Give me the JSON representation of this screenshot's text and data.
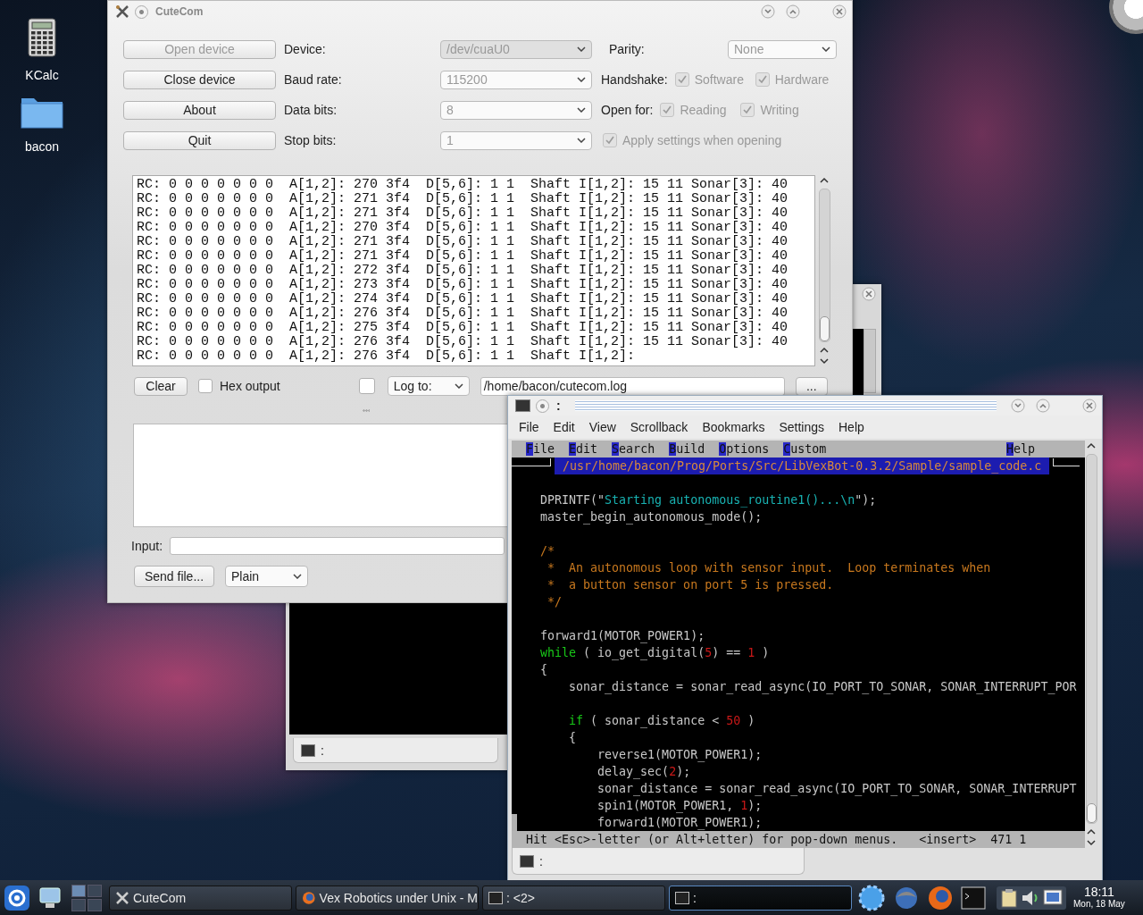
{
  "desktop_icons": [
    {
      "kind": "calculator",
      "label": "KCalc"
    },
    {
      "kind": "folder",
      "label": "bacon"
    }
  ],
  "background_terminal": {
    "tab_label": ":"
  },
  "cutecom": {
    "title": "CuteCom",
    "buttons": [
      {
        "label": "Open device",
        "disabled": true
      },
      {
        "label": "Close device",
        "disabled": false
      },
      {
        "label": "About",
        "disabled": false
      },
      {
        "label": "Quit",
        "disabled": false
      }
    ],
    "settings": [
      {
        "label": "Device:",
        "value": "/dev/cuaU0",
        "kind": "editable",
        "disabled": true
      },
      {
        "label": "Baud rate:",
        "value": "115200",
        "kind": "list",
        "disabled": true
      },
      {
        "label": "Data bits:",
        "value": "8",
        "kind": "list",
        "disabled": true
      },
      {
        "label": "Stop bits:",
        "value": "1",
        "kind": "list",
        "disabled": true
      }
    ],
    "parity": {
      "label": "Parity:",
      "value": "None",
      "disabled": true
    },
    "handshake": {
      "label": "Handshake:",
      "options": [
        {
          "label": "Software",
          "checked": true,
          "disabled": true
        },
        {
          "label": "Hardware",
          "checked": true,
          "disabled": true
        }
      ]
    },
    "open_for": {
      "label": "Open for:",
      "options": [
        {
          "label": "Reading",
          "checked": true,
          "disabled": true
        },
        {
          "label": "Writing",
          "checked": true,
          "disabled": true
        }
      ]
    },
    "apply_settings": {
      "label": "Apply settings when opening",
      "checked": true,
      "disabled": true
    },
    "output_lines": [
      "RC: 0 0 0 0 0 0 0  A[1,2]: 270 3f4  D[5,6]: 1 1  Shaft I[1,2]: 15 11 Sonar[3]: 40",
      "RC: 0 0 0 0 0 0 0  A[1,2]: 271 3f4  D[5,6]: 1 1  Shaft I[1,2]: 15 11 Sonar[3]: 40",
      "RC: 0 0 0 0 0 0 0  A[1,2]: 271 3f4  D[5,6]: 1 1  Shaft I[1,2]: 15 11 Sonar[3]: 40",
      "RC: 0 0 0 0 0 0 0  A[1,2]: 270 3f4  D[5,6]: 1 1  Shaft I[1,2]: 15 11 Sonar[3]: 40",
      "RC: 0 0 0 0 0 0 0  A[1,2]: 271 3f4  D[5,6]: 1 1  Shaft I[1,2]: 15 11 Sonar[3]: 40",
      "RC: 0 0 0 0 0 0 0  A[1,2]: 271 3f4  D[5,6]: 1 1  Shaft I[1,2]: 15 11 Sonar[3]: 40",
      "RC: 0 0 0 0 0 0 0  A[1,2]: 272 3f4  D[5,6]: 1 1  Shaft I[1,2]: 15 11 Sonar[3]: 40",
      "RC: 0 0 0 0 0 0 0  A[1,2]: 273 3f4  D[5,6]: 1 1  Shaft I[1,2]: 15 11 Sonar[3]: 40",
      "RC: 0 0 0 0 0 0 0  A[1,2]: 274 3f4  D[5,6]: 1 1  Shaft I[1,2]: 15 11 Sonar[3]: 40",
      "RC: 0 0 0 0 0 0 0  A[1,2]: 276 3f4  D[5,6]: 1 1  Shaft I[1,2]: 15 11 Sonar[3]: 40",
      "RC: 0 0 0 0 0 0 0  A[1,2]: 275 3f4  D[5,6]: 1 1  Shaft I[1,2]: 15 11 Sonar[3]: 40",
      "RC: 0 0 0 0 0 0 0  A[1,2]: 276 3f4  D[5,6]: 1 1  Shaft I[1,2]: 15 11 Sonar[3]: 40",
      "RC: 0 0 0 0 0 0 0  A[1,2]: 276 3f4  D[5,6]: 1 1  Shaft I[1,2]:"
    ],
    "clear_button": "Clear",
    "hex_output": {
      "label": "Hex output",
      "checked": false
    },
    "log": {
      "checked": false,
      "mode": "Log to:",
      "path": "/home/bacon/cutecom.log",
      "browse_button": "..."
    },
    "input": {
      "label": "Input:"
    },
    "send_file_button": "Send file...",
    "line_end": "Plain"
  },
  "konsole": {
    "title": ":",
    "menu": [
      "File",
      "Edit",
      "View",
      "Scrollback",
      "Bookmarks",
      "Settings",
      "Help"
    ],
    "editor": {
      "menu": [
        "File",
        "Edit",
        "Search",
        "Build",
        "Options",
        "Custom",
        "Help"
      ],
      "file_path": "/usr/home/bacon/Prog/Ports/Src/LibVexBot-0.3.2/Sample/sample_code.c",
      "lines": [
        {
          "kind": "blank"
        },
        {
          "kind": "code",
          "segments": [
            {
              "t": "DPRINTF(\"",
              "kind": "plain"
            },
            {
              "t": "Starting autonomous_routine1()...\\n",
              "kind": "string"
            },
            {
              "t": "\");",
              "kind": "plain"
            }
          ]
        },
        {
          "kind": "code",
          "segments": [
            {
              "t": "master_begin_autonomous_mode();",
              "kind": "plain"
            }
          ]
        },
        {
          "kind": "blank"
        },
        {
          "kind": "code",
          "segments": [
            {
              "t": "/*",
              "kind": "comment"
            }
          ]
        },
        {
          "kind": "code",
          "segments": [
            {
              "t": " *  An autonomous loop with sensor input.  Loop terminates when",
              "kind": "comment"
            }
          ]
        },
        {
          "kind": "code",
          "segments": [
            {
              "t": " *  a button sensor on port 5 is pressed.",
              "kind": "comment"
            }
          ]
        },
        {
          "kind": "code",
          "segments": [
            {
              "t": " */",
              "kind": "comment"
            }
          ]
        },
        {
          "kind": "blank"
        },
        {
          "kind": "code",
          "segments": [
            {
              "t": "forward1(MOTOR_POWER1);",
              "kind": "plain"
            }
          ]
        },
        {
          "kind": "code",
          "segments": [
            {
              "t": "while",
              "kind": "keyword"
            },
            {
              "t": " ( io_get_digital(",
              "kind": "plain"
            },
            {
              "t": "5",
              "kind": "number"
            },
            {
              "t": ") == ",
              "kind": "plain"
            },
            {
              "t": "1",
              "kind": "number"
            },
            {
              "t": " )",
              "kind": "plain"
            }
          ]
        },
        {
          "kind": "code",
          "segments": [
            {
              "t": "{",
              "kind": "plain"
            }
          ]
        },
        {
          "kind": "code",
          "segments": [
            {
              "t": "    sonar_distance = sonar_read_async(IO_PORT_TO_SONAR, SONAR_INTERRUPT_POR",
              "kind": "plain"
            }
          ]
        },
        {
          "kind": "blank"
        },
        {
          "kind": "code",
          "segments": [
            {
              "t": "    if",
              "kind": "keyword"
            },
            {
              "t": " ( sonar_distance < ",
              "kind": "plain"
            },
            {
              "t": "50",
              "kind": "number"
            },
            {
              "t": " )",
              "kind": "plain"
            }
          ]
        },
        {
          "kind": "code",
          "segments": [
            {
              "t": "    {",
              "kind": "plain"
            }
          ]
        },
        {
          "kind": "code",
          "segments": [
            {
              "t": "        reverse1(MOTOR_POWER1);",
              "kind": "plain"
            }
          ]
        },
        {
          "kind": "code",
          "segments": [
            {
              "t": "        delay_sec(",
              "kind": "plain"
            },
            {
              "t": "2",
              "kind": "number"
            },
            {
              "t": ");",
              "kind": "plain"
            }
          ]
        },
        {
          "kind": "code",
          "segments": [
            {
              "t": "        sonar_distance = sonar_read_async(IO_PORT_TO_SONAR, SONAR_INTERRUPT",
              "kind": "plain"
            }
          ]
        },
        {
          "kind": "code",
          "segments": [
            {
              "t": "        spin1(MOTOR_POWER1, ",
              "kind": "plain"
            },
            {
              "t": "1",
              "kind": "number"
            },
            {
              "t": ");",
              "kind": "plain"
            }
          ]
        },
        {
          "kind": "code",
          "segments": [
            {
              "t": "        forward1(MOTOR_POWER1);",
              "kind": "plain"
            }
          ]
        }
      ],
      "status": {
        "hint": "Hit <Esc>-letter (or Alt+letter) for pop-down menus.",
        "mode": "<insert>",
        "position": "471 1"
      }
    },
    "tab_label": ":"
  },
  "taskbar": {
    "tasks": [
      {
        "label": "CuteCom",
        "kind": "tool",
        "selected": false
      },
      {
        "label": "Vex Robotics under Unix - M",
        "kind": "browser",
        "selected": false
      },
      {
        "label": ": <2>",
        "kind": "terminal",
        "selected": false
      },
      {
        "label": ":",
        "kind": "terminal",
        "selected": true
      }
    ],
    "clock": {
      "time": "18:11",
      "date": "Mon, 18 May"
    }
  }
}
